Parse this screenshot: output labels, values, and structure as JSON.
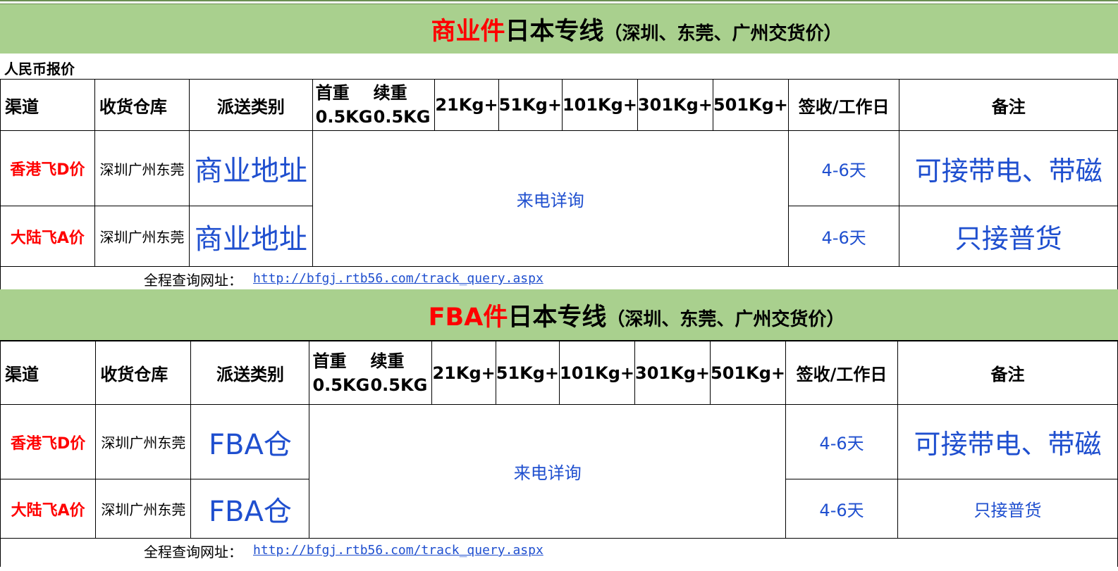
{
  "section1": {
    "title_red": "商业件",
    "title_black": "日本专线",
    "title_sub": "（深圳、东莞、广州交货价）",
    "currency_note": "人民币报价",
    "headers": {
      "channel": "渠道",
      "warehouse": "收货仓库",
      "delivery_type": "派送类别",
      "first_weight": "首重",
      "first_weight_value": "0.5KG",
      "extra_weight": "续重",
      "extra_weight_value": "0.5KG",
      "w21": "21Kg+",
      "w51": "51Kg+",
      "w101": "101Kg+",
      "w301": "301Kg+",
      "w501": "501Kg+",
      "sign_days": "签收/工作日",
      "remarks": "备注"
    },
    "rows": [
      {
        "channel": "香港飞D价",
        "warehouse": "深圳广州东莞",
        "delivery_type": "商业地址",
        "days": "4-6天",
        "remark": "可接带电、带磁"
      },
      {
        "channel": "大陆飞A价",
        "warehouse": "深圳广州东莞",
        "delivery_type": "商业地址",
        "days": "4-6天",
        "remark": "只接普货"
      }
    ],
    "price": "来电详询",
    "track_label": "全程查询网址：",
    "track_url": "http://bfgj.rtb56.com/track_query.aspx"
  },
  "section2": {
    "title_red": "FBA件",
    "title_black": "日本专线",
    "title_sub": "（深圳、东莞、广州交货价）",
    "headers": {
      "channel": "渠道",
      "warehouse": "收货仓库",
      "delivery_type": "派送类别",
      "first_weight": "首重",
      "first_weight_value": "0.5KG",
      "extra_weight": "续重",
      "extra_weight_value": "0.5KG",
      "w21": "21Kg+",
      "w51": "51Kg+",
      "w101": "101Kg+",
      "w301": "301Kg+",
      "w501": "501Kg+",
      "sign_days": "签收/工作日",
      "remarks": "备注"
    },
    "rows": [
      {
        "channel": "香港飞D价",
        "warehouse": "深圳广州东莞",
        "delivery_type": "FBA仓",
        "days": "4-6天",
        "remark": "可接带电、带磁"
      },
      {
        "channel": "大陆飞A价",
        "warehouse": "深圳广州东莞",
        "delivery_type": "FBA仓",
        "days": "4-6天",
        "remark": "只接普货"
      }
    ],
    "price": "来电详询",
    "track_label": "全程查询网址：",
    "track_url": "http://bfgj.rtb56.com/track_query.aspx"
  },
  "colors": {
    "banner": "#a9d08e",
    "red": "#ff0000",
    "blue": "#1f4fcf"
  }
}
